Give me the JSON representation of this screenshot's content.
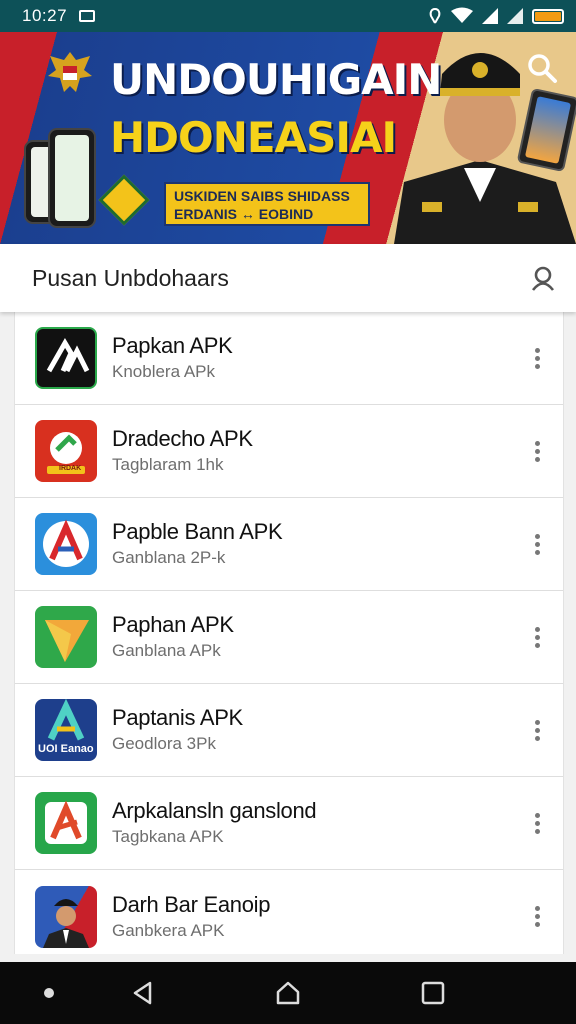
{
  "status_bar": {
    "time": "10:27",
    "notification_icon": "notification-icon",
    "icons": [
      "alarm-icon",
      "wifi-icon",
      "signal-icon",
      "signal-icon",
      "battery-icon"
    ],
    "battery_color": "#f29b13"
  },
  "banner": {
    "headline_line1": "UNDOUHIGAIN",
    "headline_line2": "HDONEASIAI",
    "promo_line1": "USKIDEN SAIBS SHIDASS",
    "promo_line2": "ERDANIS ↔ EOBIND",
    "search_icon": "search-icon",
    "colors": {
      "red": "#c8202a",
      "blue": "#1e4ba3",
      "yellow": "#f6d21a"
    }
  },
  "search_header": {
    "title": "Pusan Unbdohaars",
    "icon": "user-icon"
  },
  "apps": [
    {
      "name": "Papkan APK",
      "subtitle": "Knoblera APk",
      "icon": "pink-logo-icon"
    },
    {
      "name": "Dradecho APK",
      "subtitle": "Tagblaram 1hk",
      "icon": "red-app-icon"
    },
    {
      "name": "Papble Bann APK",
      "subtitle": "Ganblana 2P-k",
      "icon": "blue-a-icon"
    },
    {
      "name": "Paphan APK",
      "subtitle": "Ganblana APk",
      "icon": "green-arrow-icon"
    },
    {
      "name": "Paptanis APK",
      "subtitle": "Geodlora 3Pk",
      "icon": "a-letter-icon"
    },
    {
      "name": "Arpkalansln ganslond",
      "subtitle": "Tagbkana APK",
      "icon": "green-a-icon"
    },
    {
      "name": "Darh Bar Eanoip",
      "subtitle": "Ganbkera APK",
      "icon": "officer-icon"
    }
  ],
  "a_letter_caption": "UOI Eanao",
  "green_red_caption": "IRDAK",
  "nav_bar": {
    "icons": [
      "dot-icon",
      "back-icon",
      "home-icon",
      "recents-icon"
    ]
  }
}
